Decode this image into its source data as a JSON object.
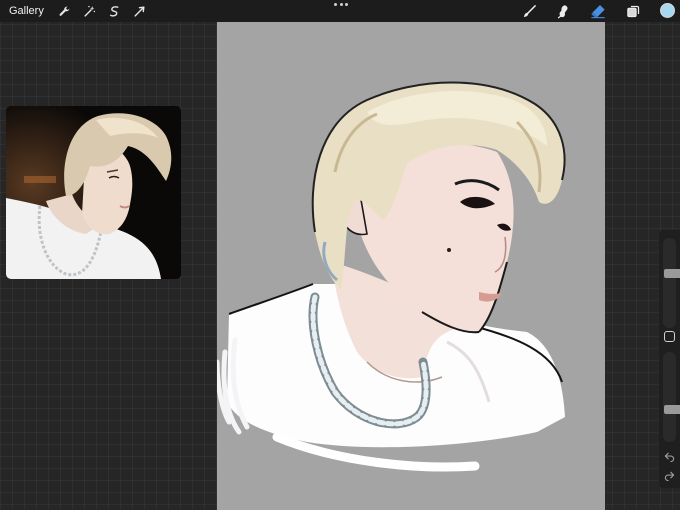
{
  "topbar": {
    "gallery_label": "Gallery",
    "left_tools": [
      "wrench-icon",
      "magic-wand-icon",
      "selection-icon",
      "transform-icon"
    ],
    "right_tools": [
      "brush-icon",
      "smudge-icon",
      "eraser-icon",
      "layers-icon"
    ],
    "active_tool": "eraser-icon",
    "active_tool_color": "#4a90e2",
    "current_color": "#a8d8f0"
  },
  "reference": {
    "description_icons": "reference-photo"
  },
  "sidebar": {
    "brush_size": 0.62,
    "brush_opacity": 0.34,
    "undo_icon": "undo-icon",
    "redo_icon": "redo-icon"
  }
}
